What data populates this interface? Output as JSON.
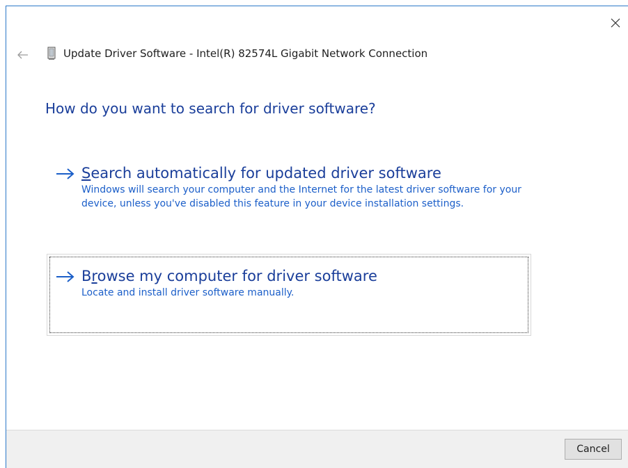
{
  "window": {
    "title": "Update Driver Software - Intel(R) 82574L Gigabit Network Connection",
    "heading": "How do you want to search for driver software?"
  },
  "options": [
    {
      "accel": "S",
      "title_rest": "earch automatically for updated driver software",
      "description": "Windows will search your computer and the Internet for the latest driver software for your device, unless you've disabled this feature in your device installation settings."
    },
    {
      "title_pre": "B",
      "accel": "r",
      "title_rest": "owse my computer for driver software",
      "description": "Locate and install driver software manually."
    }
  ],
  "footer": {
    "cancel_label": "Cancel"
  },
  "icons": {
    "close": "close-icon",
    "back": "back-arrow-icon",
    "device": "network-adapter-icon",
    "option_arrow": "arrow-right-icon"
  },
  "colors": {
    "heading": "#1a3e9a",
    "link_desc": "#1c5fc9",
    "window_border": "#2b78c8",
    "footer_bg": "#f0f0f0"
  }
}
